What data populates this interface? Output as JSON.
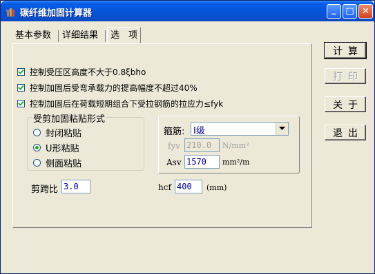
{
  "window": {
    "title": "碳纤维加固计算器",
    "app_icon": "hammer-tools-icon",
    "controls": {
      "minimize": "_",
      "maximize": "□",
      "close": "✕"
    }
  },
  "tabs": [
    {
      "label": "基本参数",
      "active": false
    },
    {
      "label": "详细结果",
      "active": false
    },
    {
      "label": "选　项",
      "active": true
    }
  ],
  "options": {
    "checkboxes": [
      {
        "label": "控制受压区高度不大于0.8ξbho",
        "checked": true
      },
      {
        "label": "控制加固后受弯承载力的提高幅度不超过40%",
        "checked": true
      },
      {
        "label": "控制加固后在荷载短期组合下受拉钢筋的拉应力≤fyk",
        "checked": true
      }
    ],
    "paste_group": {
      "title": "受剪加固粘贴形式",
      "radios": [
        {
          "label": "封闭粘贴",
          "selected": false
        },
        {
          "label": "U形粘贴",
          "selected": true
        },
        {
          "label": "侧面粘贴",
          "selected": false
        }
      ]
    },
    "stirrup": {
      "label": "箍筋:",
      "selected": "Ⅰ级",
      "fyv_label": "fyv",
      "fyv_value": "210.0",
      "fyv_unit": "N/mm²",
      "asv_label": "Asv",
      "asv_value": "1570",
      "asv_unit": "mm²/m"
    },
    "shear_span": {
      "label": "剪跨比",
      "value": "3.0"
    },
    "hcf": {
      "label": "hcf",
      "value": "400",
      "unit": "(mm)"
    }
  },
  "buttons": {
    "calculate": "计算",
    "print": "打印",
    "about": "关于",
    "exit": "退出"
  },
  "colors": {
    "title_bar": "#0553d8",
    "face": "#ece9d8",
    "input_text": "#00008b",
    "checkmark": "#21a121"
  }
}
